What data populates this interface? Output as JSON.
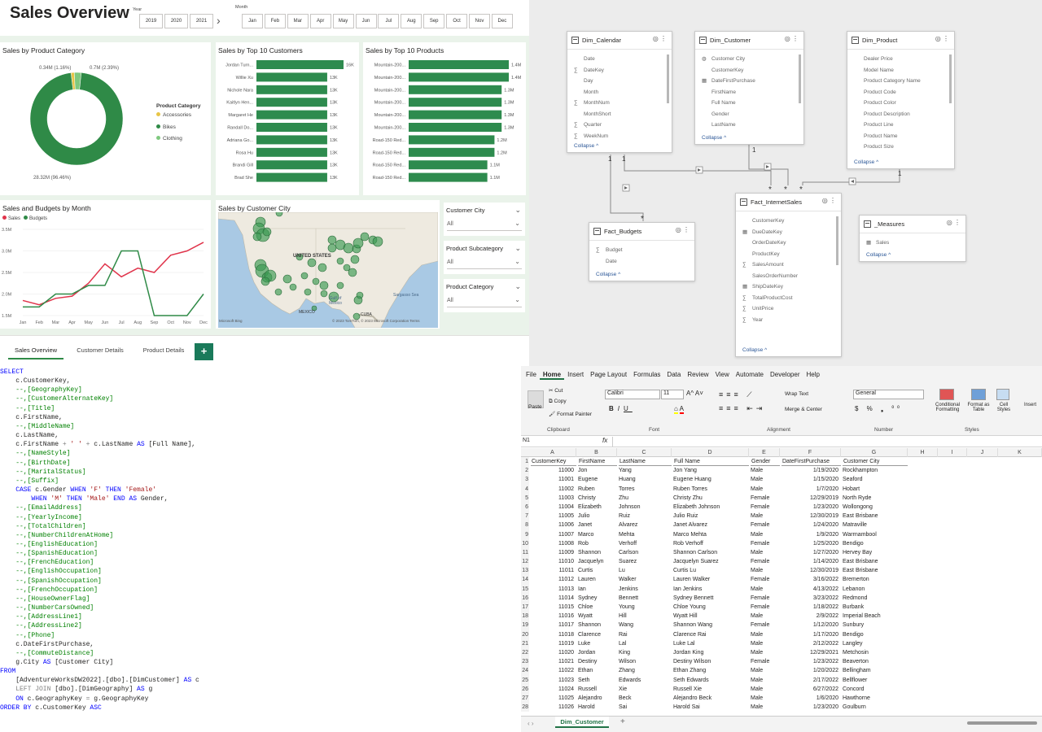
{
  "pbi": {
    "title": "Sales Overview",
    "year_label": "Year",
    "years": [
      "2019",
      "2020",
      "2021"
    ],
    "year_next": "›",
    "month_label": "Month",
    "months": [
      "Jan",
      "Feb",
      "Mar",
      "Apr",
      "May",
      "Jun",
      "Jul",
      "Aug",
      "Sep",
      "Oct",
      "Nov",
      "Dec"
    ],
    "cat_title": "Sales by Product Category",
    "cat_legend_title": "Product Category",
    "cat_legend": [
      {
        "name": "Accessories",
        "color": "#e8c547"
      },
      {
        "name": "Bikes",
        "color": "#2f8a47"
      },
      {
        "name": "Clothing",
        "color": "#7fc97f"
      }
    ],
    "cat_labels": {
      "accessories": "0.34M (1.16%)",
      "clothing": "0.7M (2.39%)",
      "bikes": "28.32M (96.46%)"
    },
    "cust_title": "Sales by Top 10 Customers",
    "prod_title": "Sales by Top 10 Products",
    "line_title": "Sales and Budgets by Month",
    "line_legend": [
      {
        "name": "Sales",
        "color": "#e0344b"
      },
      {
        "name": "Budgets",
        "color": "#2f8a47"
      }
    ],
    "map_title": "Sales by Customer City",
    "map_labels": {
      "us": "UNITED STATES",
      "mx": "MEXICO",
      "gulf": "Gulf of Mexico",
      "sargasso": "Sargasso Sea",
      "cuba": "CUBA",
      "credit": "© 2023 TomTom, © 2023 Microsoft Corporation  Terms",
      "ms": "Microsoft Bing"
    },
    "slicers": [
      {
        "title": "Customer City",
        "value": "All"
      },
      {
        "title": "Product Subcategory",
        "value": "All"
      },
      {
        "title": "Product Category",
        "value": "All"
      }
    ],
    "tabs": [
      "Sales Overview",
      "Customer Details",
      "Product Details"
    ],
    "add_tab": "+"
  },
  "chart_data": [
    {
      "type": "pie",
      "title": "Sales by Product Category",
      "categories": [
        "Accessories",
        "Bikes",
        "Clothing"
      ],
      "values": [
        0.34,
        28.32,
        0.7
      ],
      "unit": "M"
    },
    {
      "type": "bar",
      "title": "Sales by Top 10 Customers",
      "categories": [
        "Jordan Turn...",
        "Willie Xu",
        "Nichole Nara",
        "Kaitlyn Hen...",
        "Margaret He",
        "Randall Do...",
        "Adriana Go...",
        "Rosa Hu",
        "Brandi Gill",
        "Brad She"
      ],
      "values": [
        16,
        13,
        13,
        13,
        13,
        13,
        13,
        13,
        13,
        13
      ],
      "labels": [
        "16K",
        "13K",
        "13K",
        "13K",
        "13K",
        "13K",
        "13K",
        "13K",
        "13K",
        "13K"
      ]
    },
    {
      "type": "bar",
      "title": "Sales by Top 10 Products",
      "categories": [
        "Mountain-200...",
        "Mountain-200...",
        "Mountain-200...",
        "Mountain-200...",
        "Mountain-200...",
        "Mountain-200...",
        "Road-150 Red...",
        "Road-150 Red...",
        "Road-150 Red...",
        "Road-150 Red..."
      ],
      "values": [
        1.4,
        1.4,
        1.3,
        1.3,
        1.3,
        1.3,
        1.2,
        1.2,
        1.1,
        1.1
      ],
      "labels": [
        "1.4M",
        "1.4M",
        "1.3M",
        "1.3M",
        "1.3M",
        "1.3M",
        "1.2M",
        "1.2M",
        "1.1M",
        "1.1M"
      ]
    },
    {
      "type": "line",
      "title": "Sales and Budgets by Month",
      "categories": [
        "Jan",
        "Feb",
        "Mar",
        "Apr",
        "May",
        "Jun",
        "Jul",
        "Aug",
        "Sep",
        "Oct",
        "Nov",
        "Dec"
      ],
      "series": [
        {
          "name": "Sales",
          "values": [
            1.85,
            1.75,
            1.9,
            1.95,
            2.25,
            2.7,
            2.4,
            2.6,
            2.5,
            2.9,
            3.0,
            3.2
          ]
        },
        {
          "name": "Budgets",
          "values": [
            1.7,
            1.7,
            2.0,
            2.0,
            2.2,
            2.2,
            3.0,
            3.0,
            1.5,
            1.5,
            1.5,
            2.0
          ]
        }
      ],
      "yticks": [
        "1.5M",
        "2.0M",
        "2.5M",
        "3.0M",
        "3.5M"
      ],
      "ylim": [
        1.5,
        3.5
      ]
    }
  ],
  "model": {
    "tables": [
      {
        "name": "Dim_Calendar",
        "fields": [
          [
            "",
            "Date"
          ],
          [
            "∑",
            "DateKey"
          ],
          [
            "",
            "Day"
          ],
          [
            "",
            "Month"
          ],
          [
            "∑",
            "MonthNum"
          ],
          [
            "",
            "MonthShort"
          ],
          [
            "∑",
            "Quarter"
          ],
          [
            "∑",
            "WeekNum"
          ]
        ]
      },
      {
        "name": "Dim_Customer",
        "fields": [
          [
            "◍",
            "Customer City"
          ],
          [
            "",
            "CustomerKey"
          ],
          [
            "▦",
            "DateFirstPurchase"
          ],
          [
            "",
            "FirstName"
          ],
          [
            "",
            "Full Name"
          ],
          [
            "",
            "Gender"
          ],
          [
            "",
            "LastName"
          ]
        ]
      },
      {
        "name": "Dim_Product",
        "fields": [
          [
            "",
            "Dealer Price"
          ],
          [
            "",
            "Model Name"
          ],
          [
            "",
            "Product Category Name"
          ],
          [
            "",
            "Product Code"
          ],
          [
            "",
            "Product Color"
          ],
          [
            "",
            "Product Description"
          ],
          [
            "",
            "Product Line"
          ],
          [
            "",
            "Product Name"
          ],
          [
            "",
            "Product Size"
          ]
        ]
      },
      {
        "name": "Fact_Budgets",
        "fields": [
          [
            "∑",
            "Budget"
          ],
          [
            "",
            "Date"
          ]
        ]
      },
      {
        "name": "Fact_InternetSales",
        "fields": [
          [
            "",
            "CustomerKey"
          ],
          [
            "▦",
            "DueDateKey"
          ],
          [
            "",
            "OrderDateKey"
          ],
          [
            "",
            "ProductKey"
          ],
          [
            "∑",
            "SalesAmount"
          ],
          [
            "",
            "SalesOrderNumber"
          ],
          [
            "▦",
            "ShipDateKey"
          ],
          [
            "∑",
            "TotalProductCost"
          ],
          [
            "∑",
            "UnitPrice"
          ],
          [
            "∑",
            "Year"
          ]
        ]
      },
      {
        "name": "_Measures",
        "fields": [
          [
            "▦",
            "Sales"
          ]
        ]
      }
    ],
    "collapse": "Collapse ^",
    "one": "1",
    "many": "*"
  },
  "sql": {
    "lines": [
      [
        [
          "kw",
          "SELECT"
        ]
      ],
      [
        [
          "",
          "    c.CustomerKey,"
        ]
      ],
      [
        [
          "cm",
          "    --,[GeographyKey]"
        ]
      ],
      [
        [
          "cm",
          "    --,[CustomerAlternateKey]"
        ]
      ],
      [
        [
          "cm",
          "    --,[Title]"
        ]
      ],
      [
        [
          "",
          "    c.FirstName,"
        ]
      ],
      [
        [
          "cm",
          "    --,[MiddleName]"
        ]
      ],
      [
        [
          "",
          "    c.LastName,"
        ]
      ],
      [
        [
          "",
          "    c.FirstName "
        ],
        [
          "gr",
          "+"
        ],
        [
          "st",
          " ' ' "
        ],
        [
          "gr",
          "+"
        ],
        [
          "",
          " c.LastName "
        ],
        [
          "kw",
          "AS"
        ],
        [
          "",
          " [Full Name],"
        ]
      ],
      [
        [
          "cm",
          "    --,[NameStyle]"
        ]
      ],
      [
        [
          "cm",
          "    --,[BirthDate]"
        ]
      ],
      [
        [
          "cm",
          "    --,[MaritalStatus]"
        ]
      ],
      [
        [
          "cm",
          "    --,[Suffix]"
        ]
      ],
      [
        [
          "kw",
          "    CASE"
        ],
        [
          "",
          " c.Gender "
        ],
        [
          "kw",
          "WHEN"
        ],
        [
          "st",
          " 'F' "
        ],
        [
          "kw",
          "THEN"
        ],
        [
          "st",
          " 'Female'"
        ]
      ],
      [
        [
          "kw",
          "        WHEN"
        ],
        [
          "st",
          " 'M' "
        ],
        [
          "kw",
          "THEN"
        ],
        [
          "st",
          " 'Male' "
        ],
        [
          "kw",
          "END AS"
        ],
        [
          "",
          " Gender,"
        ]
      ],
      [
        [
          "cm",
          "    --,[EmailAddress]"
        ]
      ],
      [
        [
          "cm",
          "    --,[YearlyIncome]"
        ]
      ],
      [
        [
          "cm",
          "    --,[TotalChildren]"
        ]
      ],
      [
        [
          "cm",
          "    --,[NumberChildrenAtHome]"
        ]
      ],
      [
        [
          "cm",
          "    --,[EnglishEducation]"
        ]
      ],
      [
        [
          "cm",
          "    --,[SpanishEducation]"
        ]
      ],
      [
        [
          "cm",
          "    --,[FrenchEducation]"
        ]
      ],
      [
        [
          "cm",
          "    --,[EnglishOccupation]"
        ]
      ],
      [
        [
          "cm",
          "    --,[SpanishOccupation]"
        ]
      ],
      [
        [
          "cm",
          "    --,[FrenchOccupation]"
        ]
      ],
      [
        [
          "cm",
          "    --,[HouseOwnerFlag]"
        ]
      ],
      [
        [
          "cm",
          "    --,[NumberCarsOwned]"
        ]
      ],
      [
        [
          "cm",
          "    --,[AddressLine1]"
        ]
      ],
      [
        [
          "cm",
          "    --,[AddressLine2]"
        ]
      ],
      [
        [
          "cm",
          "    --,[Phone]"
        ]
      ],
      [
        [
          "",
          "    c.DateFirstPurchase,"
        ]
      ],
      [
        [
          "cm",
          "    --,[CommuteDistance]"
        ]
      ],
      [
        [
          "",
          "    g.City "
        ],
        [
          "kw",
          "AS"
        ],
        [
          "",
          " [Customer City]"
        ]
      ],
      [
        [
          "kw",
          "FROM"
        ]
      ],
      [
        [
          "",
          "    [AdventureWorksDW2022].[dbo].[DimCustomer] "
        ],
        [
          "kw",
          "AS"
        ],
        [
          "",
          " c"
        ]
      ],
      [
        [
          "gr",
          "    LEFT JOIN"
        ],
        [
          "",
          " [dbo].[DimGeography] "
        ],
        [
          "kw",
          "AS"
        ],
        [
          "",
          " g"
        ]
      ],
      [
        [
          "kw",
          "    ON"
        ],
        [
          "",
          " c.GeographyKey "
        ],
        [
          "gr",
          "="
        ],
        [
          "",
          " g.GeographyKey"
        ]
      ],
      [
        [
          "kw",
          "ORDER BY"
        ],
        [
          "",
          " c.CustomerKey "
        ],
        [
          "kw",
          "ASC"
        ]
      ]
    ]
  },
  "excel": {
    "menu": [
      "File",
      "Home",
      "Insert",
      "Page Layout",
      "Formulas",
      "Data",
      "Review",
      "View",
      "Automate",
      "Developer",
      "Help"
    ],
    "clipboard": {
      "paste": "Paste",
      "cut": "Cut",
      "copy": "Copy",
      "fmt": "Format Painter",
      "group": "Clipboard"
    },
    "font": {
      "name": "Calibri",
      "size": "11",
      "group": "Font"
    },
    "align": {
      "wrap": "Wrap Text",
      "merge": "Merge & Center",
      "group": "Alignment"
    },
    "number": {
      "fmt": "General",
      "group": "Number"
    },
    "styles": {
      "cond": "Conditional Formatting",
      "table": "Format as Table",
      "cell": "Cell Styles",
      "group": "Styles"
    },
    "insert": "Insert",
    "namebox": "N1",
    "fx": "fx",
    "cols": [
      "A",
      "B",
      "C",
      "D",
      "E",
      "F",
      "G",
      "H",
      "I",
      "J",
      "K"
    ],
    "headers": [
      "CustomerKey",
      "FirstName",
      "LastName",
      "Full Name",
      "Gender",
      "DateFirstPurchase",
      "Customer City"
    ],
    "rows": [
      [
        "11000",
        "Jon",
        "Yang",
        "Jon Yang",
        "Male",
        "1/19/2020",
        "Rockhampton"
      ],
      [
        "11001",
        "Eugene",
        "Huang",
        "Eugene Huang",
        "Male",
        "1/15/2020",
        "Seaford"
      ],
      [
        "11002",
        "Ruben",
        "Torres",
        "Ruben Torres",
        "Male",
        "1/7/2020",
        "Hobart"
      ],
      [
        "11003",
        "Christy",
        "Zhu",
        "Christy Zhu",
        "Female",
        "12/29/2019",
        "North Ryde"
      ],
      [
        "11004",
        "Elizabeth",
        "Johnson",
        "Elizabeth Johnson",
        "Female",
        "1/23/2020",
        "Wollongong"
      ],
      [
        "11005",
        "Julio",
        "Ruiz",
        "Julio Ruiz",
        "Male",
        "12/30/2019",
        "East Brisbane"
      ],
      [
        "11006",
        "Janet",
        "Alvarez",
        "Janet Alvarez",
        "Female",
        "1/24/2020",
        "Matraville"
      ],
      [
        "11007",
        "Marco",
        "Mehta",
        "Marco Mehta",
        "Male",
        "1/9/2020",
        "Warrnambool"
      ],
      [
        "11008",
        "Rob",
        "Verhoff",
        "Rob Verhoff",
        "Female",
        "1/25/2020",
        "Bendigo"
      ],
      [
        "11009",
        "Shannon",
        "Carlson",
        "Shannon Carlson",
        "Male",
        "1/27/2020",
        "Hervey Bay"
      ],
      [
        "11010",
        "Jacquelyn",
        "Suarez",
        "Jacquelyn Suarez",
        "Female",
        "1/14/2020",
        "East Brisbane"
      ],
      [
        "11011",
        "Curtis",
        "Lu",
        "Curtis Lu",
        "Male",
        "12/30/2019",
        "East Brisbane"
      ],
      [
        "11012",
        "Lauren",
        "Walker",
        "Lauren Walker",
        "Female",
        "3/16/2022",
        "Bremerton"
      ],
      [
        "11013",
        "Ian",
        "Jenkins",
        "Ian Jenkins",
        "Male",
        "4/13/2022",
        "Lebanon"
      ],
      [
        "11014",
        "Sydney",
        "Bennett",
        "Sydney Bennett",
        "Female",
        "3/23/2022",
        "Redmond"
      ],
      [
        "11015",
        "Chloe",
        "Young",
        "Chloe Young",
        "Female",
        "1/18/2022",
        "Burbank"
      ],
      [
        "11016",
        "Wyatt",
        "Hill",
        "Wyatt Hill",
        "Male",
        "2/9/2022",
        "Imperial Beach"
      ],
      [
        "11017",
        "Shannon",
        "Wang",
        "Shannon Wang",
        "Female",
        "1/12/2020",
        "Sunbury"
      ],
      [
        "11018",
        "Clarence",
        "Rai",
        "Clarence Rai",
        "Male",
        "1/17/2020",
        "Bendigo"
      ],
      [
        "11019",
        "Luke",
        "Lal",
        "Luke Lal",
        "Male",
        "2/12/2022",
        "Langley"
      ],
      [
        "11020",
        "Jordan",
        "King",
        "Jordan King",
        "Male",
        "12/29/2021",
        "Metchosin"
      ],
      [
        "11021",
        "Destiny",
        "Wilson",
        "Destiny Wilson",
        "Female",
        "1/23/2022",
        "Beaverton"
      ],
      [
        "11022",
        "Ethan",
        "Zhang",
        "Ethan Zhang",
        "Male",
        "1/20/2022",
        "Bellingham"
      ],
      [
        "11023",
        "Seth",
        "Edwards",
        "Seth Edwards",
        "Male",
        "2/17/2022",
        "Bellflower"
      ],
      [
        "11024",
        "Russell",
        "Xie",
        "Russell Xie",
        "Male",
        "6/27/2022",
        "Concord"
      ],
      [
        "11025",
        "Alejandro",
        "Beck",
        "Alejandro Beck",
        "Male",
        "1/6/2020",
        "Hawthorne"
      ],
      [
        "11026",
        "Harold",
        "Sai",
        "Harold Sai",
        "Male",
        "1/23/2020",
        "Goulburn"
      ]
    ],
    "sheet": "Dim_Customer",
    "addsheet": "+"
  }
}
